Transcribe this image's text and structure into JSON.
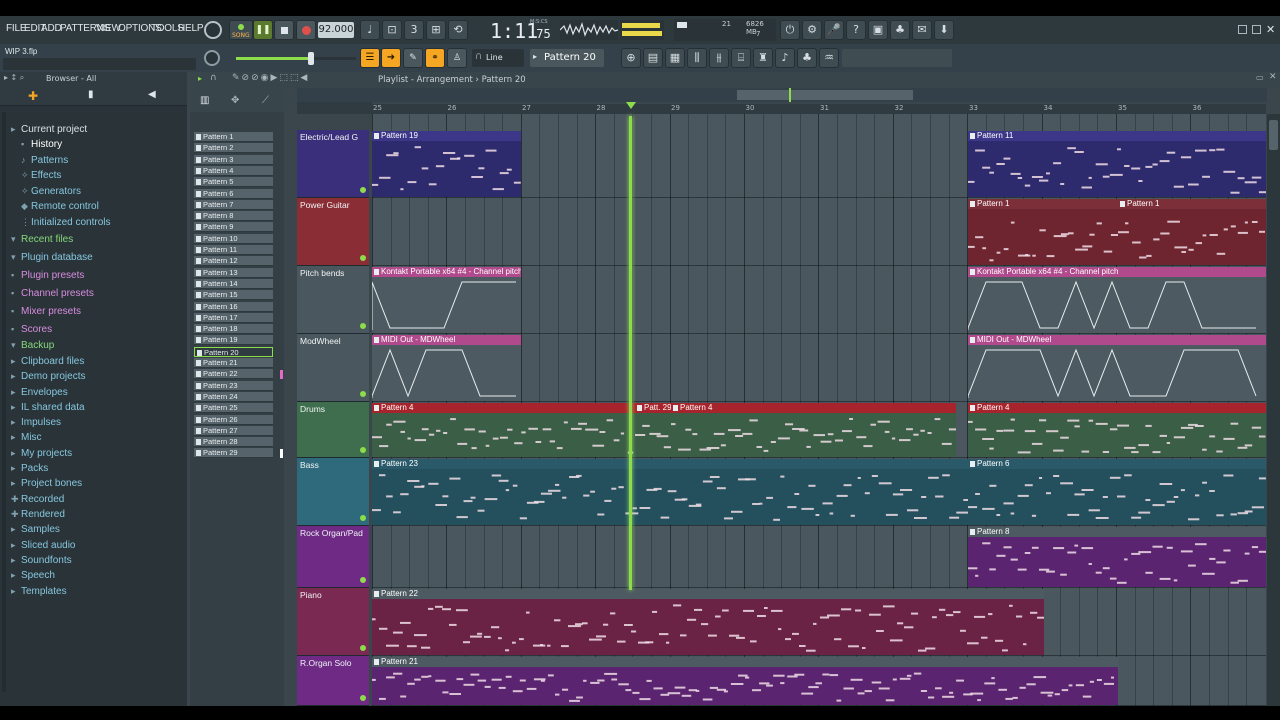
{
  "menu": [
    "FILE",
    "EDIT",
    "ADD",
    "PATTERNS",
    "VIEW",
    "OPTIONS",
    "TOOLS",
    "HELP"
  ],
  "transport": {
    "song_label": "SONG",
    "tempo": "92.000",
    "time_main": "1:11",
    "time_sub": ":75",
    "time_unit": "M:S:CS"
  },
  "monitor": {
    "cpu": "21",
    "memory": "6826 MB",
    "poly": "7"
  },
  "hint_file": "WIP 3.flp",
  "snap_mode": "Line",
  "current_pattern": "Pattern 20",
  "browser": {
    "header": "Browser - All",
    "items": [
      {
        "label": "Current project",
        "icon": "folder-icon",
        "color": "#d8e2e6"
      },
      {
        "label": "History",
        "icon": "history-icon",
        "color": "#ffffff"
      },
      {
        "label": "Patterns",
        "icon": "note-icon",
        "color": "#86c6df"
      },
      {
        "label": "Effects",
        "icon": "effects-icon",
        "color": "#86c6df"
      },
      {
        "label": "Generators",
        "icon": "generator-icon",
        "color": "#86c6df"
      },
      {
        "label": "Remote control",
        "icon": "remote-icon",
        "color": "#86c6df"
      },
      {
        "label": "Initialized controls",
        "icon": "controls-icon",
        "color": "#86c6df"
      },
      {
        "label": "Recent files",
        "icon": "recent-icon",
        "color": "#84d67a"
      },
      {
        "label": "Plugin database",
        "icon": "plugin-icon",
        "color": "#86c6df"
      },
      {
        "label": "Plugin presets",
        "icon": "preset-icon",
        "color": "#d98be0"
      },
      {
        "label": "Channel presets",
        "icon": "preset-icon",
        "color": "#d98be0"
      },
      {
        "label": "Mixer presets",
        "icon": "preset-icon",
        "color": "#d98be0"
      },
      {
        "label": "Scores",
        "icon": "score-icon",
        "color": "#d98be0"
      },
      {
        "label": "Backup",
        "icon": "backup-icon",
        "color": "#84d67a"
      },
      {
        "label": "Clipboard files",
        "icon": "folder-icon",
        "color": "#86c6df"
      },
      {
        "label": "Demo projects",
        "icon": "folder-icon",
        "color": "#86c6df"
      },
      {
        "label": "Envelopes",
        "icon": "folder-icon",
        "color": "#86c6df"
      },
      {
        "label": "IL shared data",
        "icon": "folder-icon",
        "color": "#86c6df"
      },
      {
        "label": "Impulses",
        "icon": "folder-icon",
        "color": "#86c6df"
      },
      {
        "label": "Misc",
        "icon": "folder-icon",
        "color": "#86c6df"
      },
      {
        "label": "My projects",
        "icon": "folder-icon",
        "color": "#86c6df"
      },
      {
        "label": "Packs",
        "icon": "packs-icon",
        "color": "#86c6df"
      },
      {
        "label": "Project bones",
        "icon": "folder-icon",
        "color": "#86c6df"
      },
      {
        "label": "Recorded",
        "icon": "recorded-icon",
        "color": "#86c6df"
      },
      {
        "label": "Rendered",
        "icon": "rendered-icon",
        "color": "#86c6df"
      },
      {
        "label": "Samples",
        "icon": "folder-icon",
        "color": "#86c6df"
      },
      {
        "label": "Sliced audio",
        "icon": "folder-icon",
        "color": "#86c6df"
      },
      {
        "label": "Soundfonts",
        "icon": "folder-icon",
        "color": "#86c6df"
      },
      {
        "label": "Speech",
        "icon": "folder-icon",
        "color": "#86c6df"
      },
      {
        "label": "Templates",
        "icon": "folder-icon",
        "color": "#86c6df"
      }
    ]
  },
  "patterns": [
    "Pattern 1",
    "Pattern 2",
    "Pattern 3",
    "Pattern 4",
    "Pattern 5",
    "Pattern 6",
    "Pattern 7",
    "Pattern 8",
    "Pattern 9",
    "Pattern 10",
    "Pattern 11",
    "Pattern 12",
    "Pattern 13",
    "Pattern 14",
    "Pattern 15",
    "Pattern 16",
    "Pattern 17",
    "Pattern 18",
    "Pattern 19",
    "Pattern 20",
    "Pattern 21",
    "Pattern 22",
    "Pattern 23",
    "Pattern 24",
    "Pattern 25",
    "Pattern 26",
    "Pattern 27",
    "Pattern 28",
    "Pattern 29"
  ],
  "selected_pattern": "Pattern 20",
  "playlist": {
    "breadcrumb": "Playlist - Arrangement › Pattern 20",
    "bars": [
      "25",
      "26",
      "27",
      "28",
      "29",
      "30",
      "31",
      "32",
      "33",
      "34",
      "35",
      "36"
    ],
    "tracks": [
      {
        "name": "Electric/Lead G",
        "color": "#3a2f7a"
      },
      {
        "name": "Power Guitar",
        "color": "#8a2d35"
      },
      {
        "name": "Pitch bends",
        "color": "#4a575e"
      },
      {
        "name": "ModWheel",
        "color": "#4a575e"
      },
      {
        "name": "Drums",
        "color": "#3f6e4e"
      },
      {
        "name": "Bass",
        "color": "#2f6a7c"
      },
      {
        "name": "Rock Organ/Pad",
        "color": "#6e2a85"
      },
      {
        "name": "Piano",
        "color": "#7a2a52"
      },
      {
        "name": "R.Organ Solo",
        "color": "#6e2a85"
      }
    ],
    "clips": [
      {
        "track": 0,
        "label": "Pattern 19",
        "bg": "#2e2a6e",
        "hdr": "#3c3788"
      },
      {
        "track": 0,
        "label": "Pattern 11",
        "bg": "#2e2a6e",
        "hdr": "#3c3788"
      },
      {
        "track": 1,
        "label": "Pattern 1",
        "bg": "#6e2530",
        "hdr": "#7c2e39"
      },
      {
        "track": 1,
        "label": "Pattern 1",
        "bg": "#6e2530",
        "hdr": "#7c2e39"
      },
      {
        "track": 2,
        "label": "Kontakt Portable x64 #4 - Channel pitch",
        "bg": "#4d5a61",
        "hdr": "#b04a8c"
      },
      {
        "track": 2,
        "label": "Kontakt Portable x64 #4 - Channel pitch",
        "bg": "#4d5a61",
        "hdr": "#b04a8c"
      },
      {
        "track": 3,
        "label": "MIDI Out - MDWheel",
        "bg": "#4d5a61",
        "hdr": "#b04a8c"
      },
      {
        "track": 3,
        "label": "MIDI Out - MDWheel",
        "bg": "#4d5a61",
        "hdr": "#b04a8c"
      },
      {
        "track": 4,
        "label": "Pattern 4",
        "bg": "#3b5e46",
        "hdr": "#a8242c"
      },
      {
        "track": 4,
        "label": "Patt. 29",
        "bg": "#3b5e46",
        "hdr": "#a8242c"
      },
      {
        "track": 4,
        "label": "Pattern 4",
        "bg": "#3b5e46",
        "hdr": "#a8242c"
      },
      {
        "track": 4,
        "label": "Pattern 4",
        "bg": "#3b5e46",
        "hdr": "#a8242c"
      },
      {
        "track": 5,
        "label": "Pattern 23",
        "bg": "#24505e",
        "hdr": "#2a5a6a"
      },
      {
        "track": 5,
        "label": "Pattern 6",
        "bg": "#24505e",
        "hdr": "#2a5a6a"
      },
      {
        "track": 6,
        "label": "Pattern 8",
        "bg": "#5a2470",
        "hdr": "#4d5a61"
      },
      {
        "track": 7,
        "label": "Pattern 22",
        "bg": "#6a2345",
        "hdr": "#4d5a61"
      },
      {
        "track": 8,
        "label": "Pattern 21",
        "bg": "#5a2470",
        "hdr": "#4d5a61"
      }
    ]
  }
}
